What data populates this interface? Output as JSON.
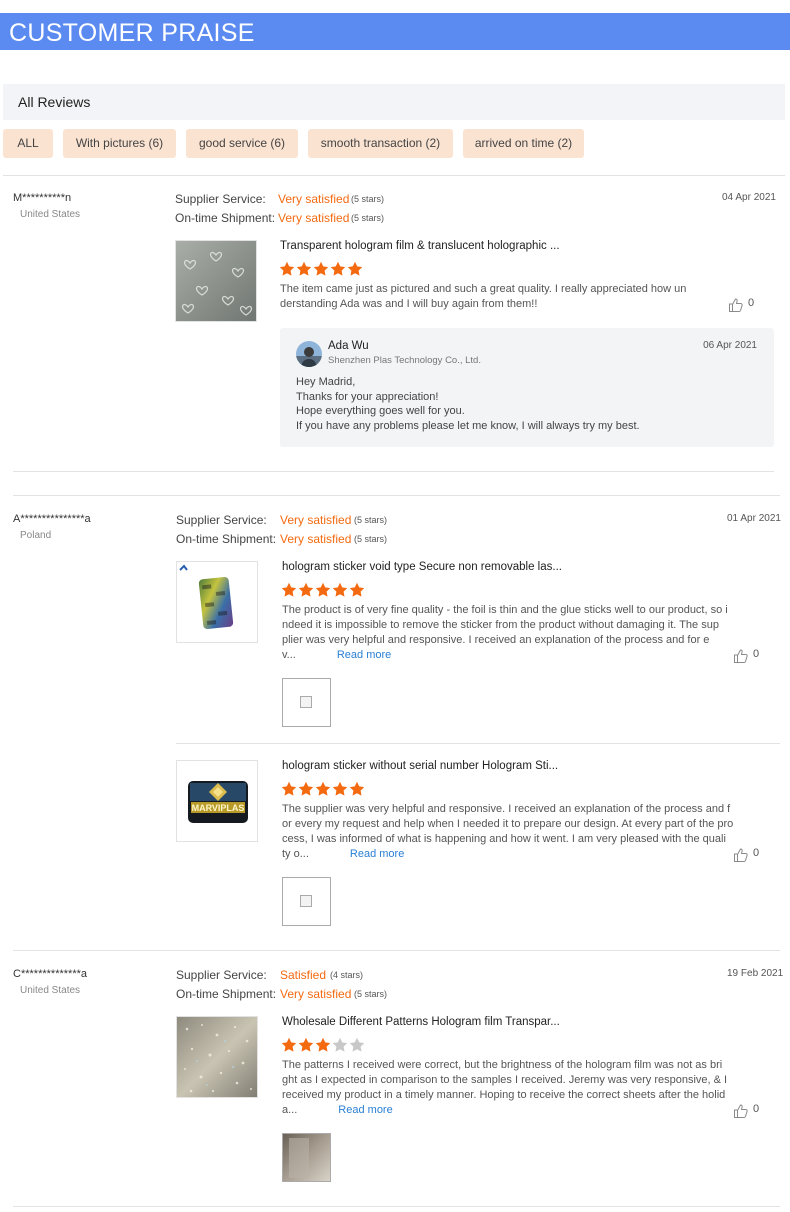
{
  "banner": {
    "title": "CUSTOMER PRAISE"
  },
  "all_reviews_label": "All Reviews",
  "filters": [
    "ALL",
    "With pictures (6)",
    "good service (6)",
    "smooth transaction (2)",
    "arrived on time (2)"
  ],
  "labels": {
    "supplier_service": "Supplier Service:",
    "ontime_shipment": "On-time Shipment:",
    "read_more": "Read more"
  },
  "colors": {
    "banner": "#5b8bf1",
    "satisfied": "#f46a10",
    "filter_bg": "#fbe3d2",
    "link": "#2a7fd4",
    "star_on": "#f46a10",
    "star_off": "#c8c8c8"
  },
  "reviews": [
    {
      "reviewer": "M**********n",
      "country": "United States",
      "date": "04 Apr 2021",
      "supplier_service": {
        "text": "Very satisfied",
        "stars": "(5 stars)"
      },
      "ontime_shipment": {
        "text": "Very satisfied",
        "stars": "(5 stars)"
      },
      "items": [
        {
          "thumb_icon": "hologram-hearts-film-image",
          "title": "Transparent hologram film & translucent holographic ...",
          "rating": 5,
          "text": "The item came just as pictured and such a great quality. I really appreciated how understanding Ada was and I will buy again from them!!",
          "likes": "0"
        }
      ],
      "reply": {
        "name": "Ada Wu",
        "company": "Shenzhen Plas Technology Co., Ltd.",
        "date": "06 Apr 2021",
        "lines": [
          "Hey Madrid,",
          "Thanks for your appreciation!",
          "Hope everything goes well for you.",
          "If you have any problems please let me know, I will always try my best."
        ]
      }
    },
    {
      "reviewer": "A***************a",
      "country": "Poland",
      "date": "01 Apr 2021",
      "supplier_service": {
        "text": "Very satisfied",
        "stars": "(5 stars)"
      },
      "ontime_shipment": {
        "text": "Very satisfied",
        "stars": "(5 stars)"
      },
      "items": [
        {
          "thumb_icon": "hologram-void-sticker-image",
          "title": "hologram sticker void type Secure non removable las...",
          "rating": 5,
          "text_lines": [
            "The product is of very fine quality - the foil is thin and the glue sticks well to our product, so i",
            "ndeed it is impossible to remove the sticker from the product without damaging it. The sup",
            "plier was very helpful and responsive. I received an explanation of the process and for e",
            "v..."
          ],
          "likes": "0"
        },
        {
          "thumb_icon": "marviplas-hologram-sticker-image",
          "thumb_text": "MARVIPLAS",
          "title": "hologram sticker without serial number Hologram Sti...",
          "rating": 5,
          "text_lines": [
            "The supplier was very helpful and responsive. I received an explanation of the process and f",
            "or every my request and help when I needed it to prepare our design. At every part of the pro",
            "cess, I was informed of what is happening and how it went. I am very pleased with the quali",
            "ty o..."
          ],
          "likes": "0"
        }
      ]
    },
    {
      "reviewer": "C**************a",
      "country": "United States",
      "date": "19 Feb 2021",
      "supplier_service": {
        "text": "Satisfied",
        "stars": "(4 stars)"
      },
      "ontime_shipment": {
        "text": "Very satisfied",
        "stars": "(5 stars)"
      },
      "items": [
        {
          "thumb_icon": "sparkle-hologram-film-image",
          "title": "Wholesale Different Patterns Hologram film Transpar...",
          "rating": 3,
          "text_lines": [
            "The patterns I received were correct, but the brightness of the hologram film was not as bri",
            "ght as I expected in comparison to the samples I received. Jeremy was very responsive, & I",
            "received my product in a timely manner. Hoping to receive the correct sheets after the holid",
            "a..."
          ],
          "likes": "0"
        }
      ]
    }
  ]
}
